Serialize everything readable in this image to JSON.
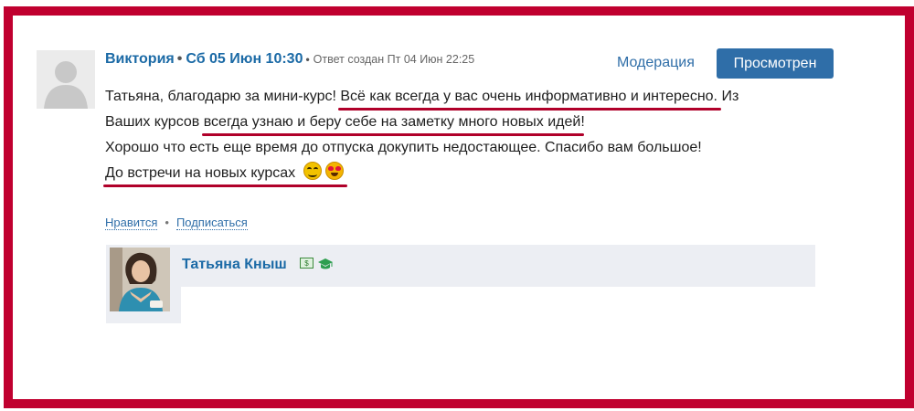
{
  "comment": {
    "author": "Виктория",
    "date": "Сб 05 Июн 10:30",
    "created_note": "Ответ создан Пт 04 Июн 22:25",
    "moderation_label": "Модерация",
    "viewed_button": "Просмотрен",
    "lines": {
      "l1_a": "Татьяна, благодарю за мини-курс! ",
      "l1_b": "Всё как всегда у вас очень информативно и интересно.",
      "l1_c": " Из",
      "l2_a": "Ваших курсов ",
      "l2_b": "всегда узнаю и беру себе на заметку много новых идей",
      "l2_c": "!",
      "l3": "Хорошо что есть еще время до отпуска докупить недостающее. Спасибо вам большое!",
      "l4": "До встречи на новых курсах"
    },
    "emojis": [
      "smiling-face-icon",
      "heart-eyes-icon"
    ],
    "actions": {
      "like": "Нравится",
      "subscribe": "Подписаться"
    }
  },
  "reply": {
    "author": "Татьяна Кныш",
    "badges": [
      "money-badge-icon",
      "graduation-cap-icon"
    ]
  },
  "colors": {
    "frame": "#c0002f",
    "link": "#1b6aa6",
    "button": "#2f6ea8",
    "underline": "#b0002a",
    "reply_bg": "#eceef3"
  }
}
